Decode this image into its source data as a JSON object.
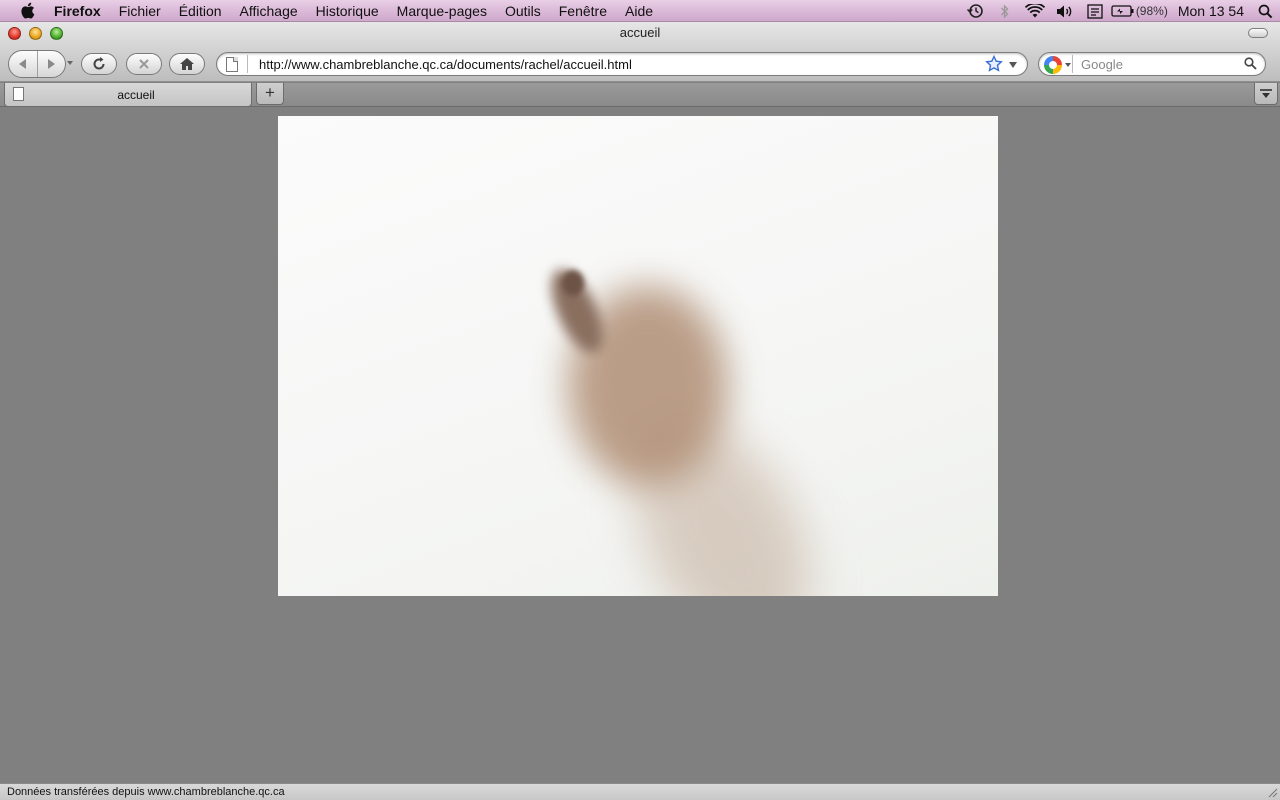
{
  "menubar": {
    "app_name": "Firefox",
    "items": [
      "Fichier",
      "Édition",
      "Affichage",
      "Historique",
      "Marque-pages",
      "Outils",
      "Fenêtre",
      "Aide"
    ],
    "battery": "(98%)",
    "clock": "Mon 13 54"
  },
  "window": {
    "title": "accueil"
  },
  "toolbar": {
    "url": "http://www.chambreblanche.qc.ca/documents/rachel/accueil.html",
    "search_placeholder": "Google"
  },
  "tabs": [
    {
      "label": "accueil"
    }
  ],
  "tab_strip": {
    "new_tab_label": "+"
  },
  "status": {
    "text": "Données transférées depuis www.chambreblanche.qc.ca"
  },
  "colors": {
    "page_background": "#808080",
    "menubar": "#d9b6d6"
  }
}
